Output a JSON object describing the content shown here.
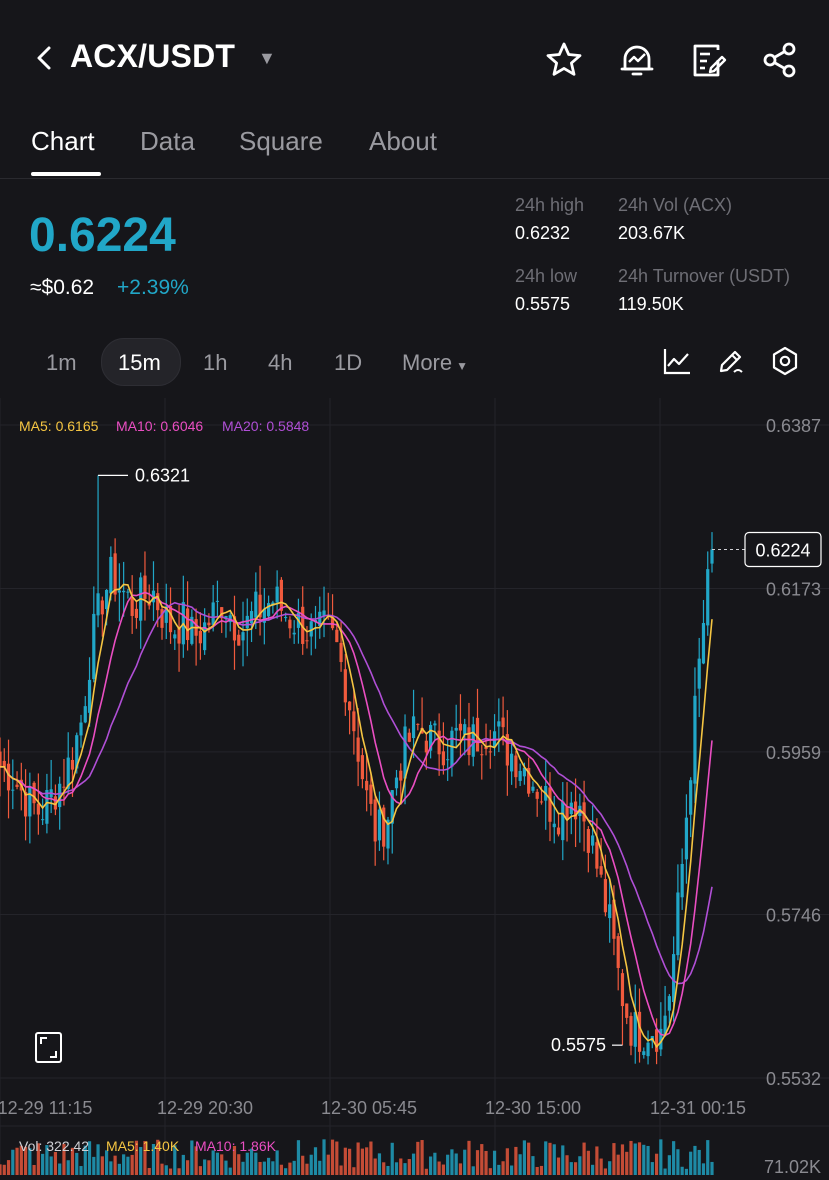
{
  "header": {
    "pair": "ACX/USDT",
    "icons": [
      "back-arrow-icon",
      "star-icon",
      "price-alert-icon",
      "notes-icon",
      "share-icon"
    ]
  },
  "tabs": [
    {
      "label": "Chart",
      "active": true
    },
    {
      "label": "Data",
      "active": false
    },
    {
      "label": "Square",
      "active": false
    },
    {
      "label": "About",
      "active": false
    }
  ],
  "ticker": {
    "price": "0.6224",
    "usd": "≈$0.62",
    "change": "+2.39%",
    "high_label": "24h high",
    "high": "0.6232",
    "vol_label": "24h Vol (ACX)",
    "vol": "203.67K",
    "low_label": "24h low",
    "low": "0.5575",
    "turnover_label": "24h Turnover (USDT)",
    "turnover": "119.50K"
  },
  "intervals": {
    "items": [
      "1m",
      "15m",
      "1h",
      "4h",
      "1D"
    ],
    "active": "15m",
    "more": "More"
  },
  "colors": {
    "up": "#21a7c8",
    "down": "#f05a3d",
    "ma5": "#f5c542",
    "ma10": "#ea4ec2",
    "ma20": "#b04fd6",
    "background": "#16161a"
  },
  "indicators": {
    "ma5": "MA5: 0.6165",
    "ma10": "MA10: 0.6046",
    "ma20": "MA20: 0.5848"
  },
  "volume_indicators": {
    "vol": "Vol: 322.42",
    "ma5": "MA5: 1.40K",
    "ma10": "MA10: 1.86K",
    "axis_top": "71.02K"
  },
  "chart_data": {
    "type": "candlestick",
    "ylim": [
      0.5532,
      0.6387
    ],
    "y_ticks": [
      "0.6387",
      "0.6173",
      "0.5959",
      "0.5746",
      "0.5532"
    ],
    "x_ticks": [
      "12-29 11:15",
      "12-29 20:30",
      "12-30 05:45",
      "12-30 15:00",
      "12-31 00:15"
    ],
    "annotations": {
      "max": "0.6321",
      "min": "0.5575",
      "last": "0.6224"
    },
    "close_path": [
      0.594,
      0.593,
      0.591,
      0.589,
      0.588,
      0.59,
      0.592,
      0.595,
      0.6,
      0.61,
      0.616,
      0.619,
      0.617,
      0.615,
      0.616,
      0.617,
      0.614,
      0.612,
      0.613,
      0.611,
      0.612,
      0.614,
      0.616,
      0.613,
      0.612,
      0.614,
      0.615,
      0.616,
      0.614,
      0.613,
      0.612,
      0.611,
      0.612,
      0.61,
      0.605,
      0.598,
      0.59,
      0.585,
      0.587,
      0.593,
      0.597,
      0.599,
      0.598,
      0.597,
      0.597,
      0.598,
      0.597,
      0.598,
      0.599,
      0.598,
      0.596,
      0.595,
      0.593,
      0.591,
      0.589,
      0.588,
      0.59,
      0.589,
      0.585,
      0.579,
      0.573,
      0.565,
      0.56,
      0.559,
      0.56,
      0.559,
      0.566,
      0.58,
      0.596,
      0.611,
      0.622
    ]
  }
}
